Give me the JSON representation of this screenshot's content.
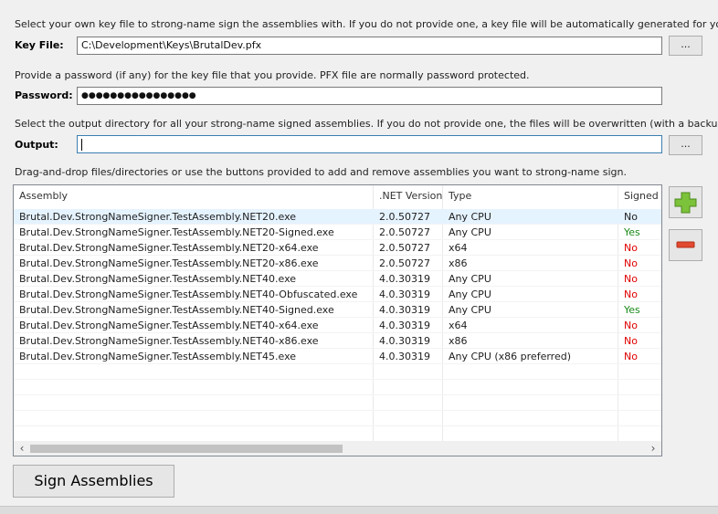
{
  "key_file": {
    "hint": "Select your own key file to strong-name sign the assemblies with. If you do not provide one, a key file will be automatically generated for you.",
    "label": "Key File:",
    "value": "C:\\Development\\Keys\\BrutalDev.pfx",
    "browse_label": "..."
  },
  "password": {
    "hint": "Provide a password (if any) for the key file that you provide. PFX file are normally password protected.",
    "label": "Password:",
    "value": "●●●●●●●●●●●●●●●●"
  },
  "output": {
    "hint": "Select the output directory for all your strong-name signed assemblies. If you do not provide one, the files will be overwritten (with a backup).",
    "label": "Output:",
    "value": "",
    "browse_label": "..."
  },
  "assemblies": {
    "hint": "Drag-and-drop files/directories or use the buttons provided to add and remove assemblies you want to strong-name sign.",
    "columns": [
      "Assembly",
      ".NET Version",
      "Type",
      "Signed"
    ],
    "rows": [
      {
        "name": "Brutal.Dev.StrongNameSigner.TestAssembly.NET20.exe",
        "version": "2.0.50727",
        "type": "Any CPU",
        "signed": "No"
      },
      {
        "name": "Brutal.Dev.StrongNameSigner.TestAssembly.NET20-Signed.exe",
        "version": "2.0.50727",
        "type": "Any CPU",
        "signed": "Yes"
      },
      {
        "name": "Brutal.Dev.StrongNameSigner.TestAssembly.NET20-x64.exe",
        "version": "2.0.50727",
        "type": "x64",
        "signed": "No"
      },
      {
        "name": "Brutal.Dev.StrongNameSigner.TestAssembly.NET20-x86.exe",
        "version": "2.0.50727",
        "type": "x86",
        "signed": "No"
      },
      {
        "name": "Brutal.Dev.StrongNameSigner.TestAssembly.NET40.exe",
        "version": "4.0.30319",
        "type": "Any CPU",
        "signed": "No"
      },
      {
        "name": "Brutal.Dev.StrongNameSigner.TestAssembly.NET40-Obfuscated.exe",
        "version": "4.0.30319",
        "type": "Any CPU",
        "signed": "No"
      },
      {
        "name": "Brutal.Dev.StrongNameSigner.TestAssembly.NET40-Signed.exe",
        "version": "4.0.30319",
        "type": "Any CPU",
        "signed": "Yes"
      },
      {
        "name": "Brutal.Dev.StrongNameSigner.TestAssembly.NET40-x64.exe",
        "version": "4.0.30319",
        "type": "x64",
        "signed": "No"
      },
      {
        "name": "Brutal.Dev.StrongNameSigner.TestAssembly.NET40-x86.exe",
        "version": "4.0.30319",
        "type": "x86",
        "signed": "No"
      },
      {
        "name": "Brutal.Dev.StrongNameSigner.TestAssembly.NET45.exe",
        "version": "4.0.30319",
        "type": "Any CPU (x86 preferred)",
        "signed": "No"
      }
    ],
    "add_icon": "plus-icon",
    "remove_icon": "minus-icon"
  },
  "sign_button_label": "Sign Assemblies",
  "colors": {
    "signed_yes": "#1a8a1a",
    "signed_no": "#e00000",
    "signed_first_row": "#1e1e1e",
    "add_icon_green": "#7cc23a",
    "remove_icon_red": "#e2492f"
  }
}
